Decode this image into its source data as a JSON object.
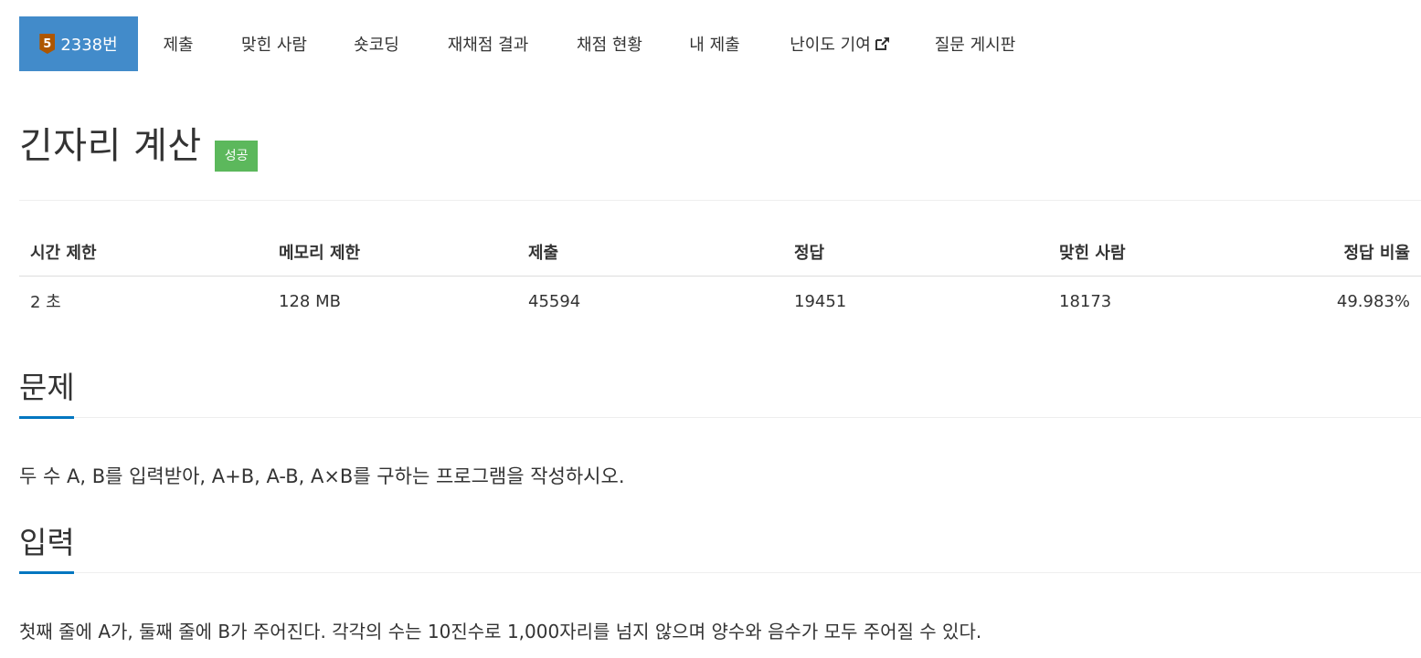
{
  "tabs": {
    "problem": {
      "tier": "5",
      "label": "2338번"
    },
    "submit": "제출",
    "solvers": "맞힌 사람",
    "shortcoding": "숏코딩",
    "rejudge": "재채점 결과",
    "status": "채점 현황",
    "my_submissions": "내 제출",
    "difficulty": "난이도 기여",
    "board": "질문 게시판"
  },
  "problem": {
    "title": "긴자리 계산",
    "result_badge": "성공"
  },
  "info_table": {
    "headers": [
      "시간 제한",
      "메모리 제한",
      "제출",
      "정답",
      "맞힌 사람",
      "정답 비율"
    ],
    "values": [
      "2 초",
      "128 MB",
      "45594",
      "19451",
      "18173",
      "49.983%"
    ]
  },
  "sections": {
    "description": {
      "heading": "문제",
      "body": "두 수 A, B를 입력받아, A+B, A-B, A×B를 구하는 프로그램을 작성하시오."
    },
    "input": {
      "heading": "입력",
      "body": "첫째 줄에 A가, 둘째 줄에 B가 주어진다. 각각의 수는 10진수로 1,000자리를 넘지 않으며 양수와 음수가 모두 주어질 수 있다."
    }
  },
  "colors": {
    "active_tab": "#428bca",
    "tier_bronze": "#ad5600",
    "success_badge": "#5cb85c",
    "section_accent": "#0076c0"
  },
  "icons": {
    "tier": "bronze-tier-5-icon",
    "external_link": "external-link-icon"
  }
}
